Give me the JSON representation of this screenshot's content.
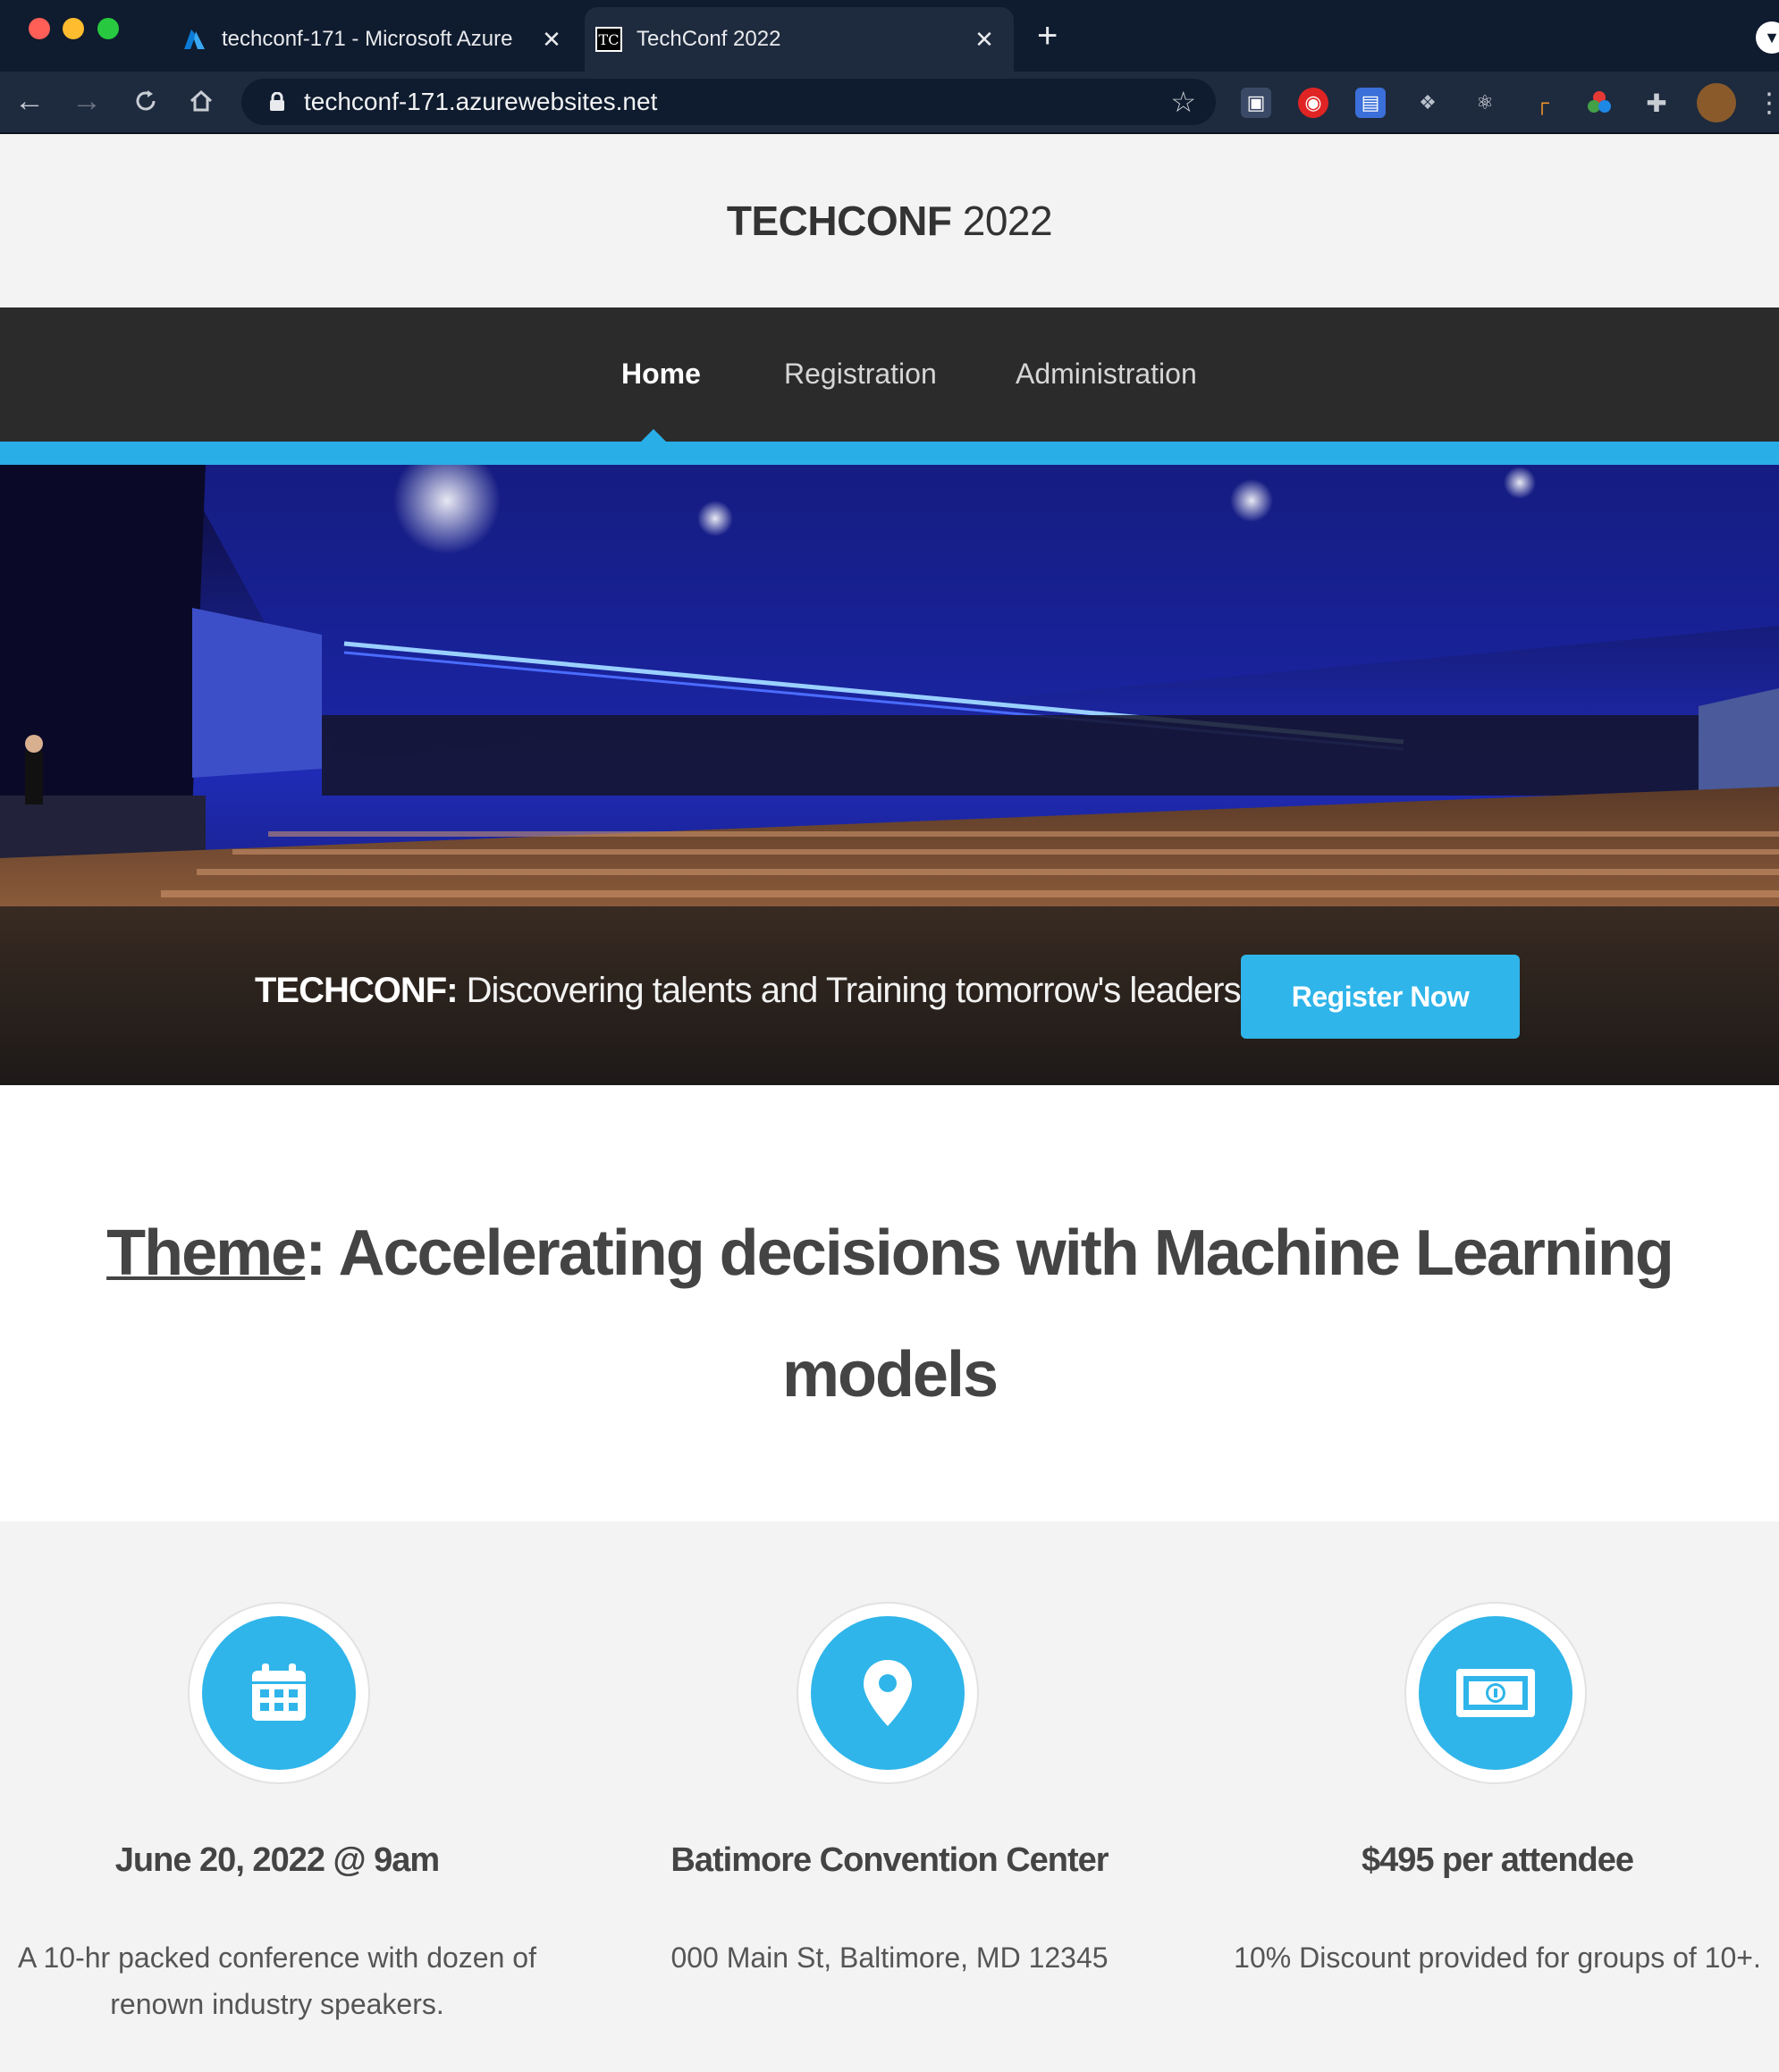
{
  "browser": {
    "tabs": [
      {
        "title": "techconf-171 - Microsoft Azure",
        "icon": "azure-icon",
        "active": false
      },
      {
        "title": "TechConf 2022",
        "icon": "tc-icon",
        "favicon_text": "TC",
        "active": true
      }
    ],
    "address_bar": {
      "url": "techconf-171.azurewebsites.net"
    }
  },
  "site": {
    "logo_bold": "TECHCONF",
    "logo_year": " 2022",
    "nav": [
      {
        "label": "Home",
        "active": true
      },
      {
        "label": "Registration",
        "active": false
      },
      {
        "label": "Administration",
        "active": false
      }
    ],
    "accent_color": "#29aee8"
  },
  "hero": {
    "tagline_bold": "TECHCONF:",
    "tagline_text": " Discovering talents and Training tomorrow's leaders",
    "cta_label": "Register Now"
  },
  "theme": {
    "label": "Theme",
    "title": ": Accelerating decisions with Machine Learning models"
  },
  "features": [
    {
      "icon": "calendar-icon",
      "heading": "June 20, 2022 @ 9am",
      "text": "A 10-hr packed conference with dozen of renown industry speakers."
    },
    {
      "icon": "location-pin-icon",
      "heading": "Batimore Convention Center",
      "text": "000 Main St, Baltimore, MD 12345"
    },
    {
      "icon": "money-icon",
      "heading": "$495 per attendee",
      "text": "10% Discount provided for groups of 10+."
    }
  ]
}
